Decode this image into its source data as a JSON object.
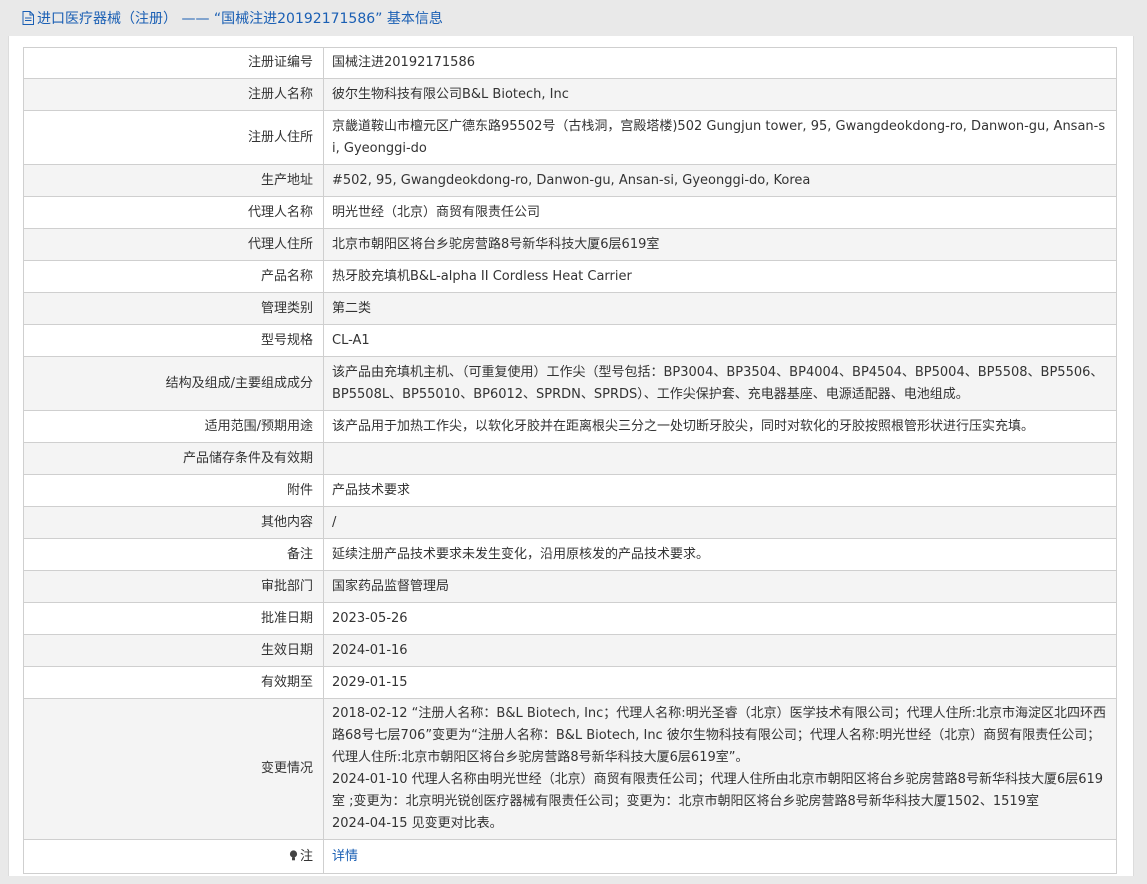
{
  "header": {
    "icon": "document-icon",
    "title": "进口医疗器械（注册） —— “国械注进20192171586” 基本信息"
  },
  "rows": [
    {
      "label": "注册证编号",
      "value": "国械注进20192171586"
    },
    {
      "label": "注册人名称",
      "value": "彼尔生物科技有限公司B&L Biotech, Inc"
    },
    {
      "label": "注册人住所",
      "value": "京畿道鞍山市檀元区广德东路95502号（古栈洞，宫殿塔楼)502 Gungjun tower, 95, Gwangdeokdong-ro, Danwon-gu, Ansan-si, Gyeonggi-do"
    },
    {
      "label": "生产地址",
      "value": "#502, 95, Gwangdeokdong-ro, Danwon-gu, Ansan-si, Gyeonggi-do, Korea"
    },
    {
      "label": "代理人名称",
      "value": "明光世经（北京）商贸有限责任公司"
    },
    {
      "label": "代理人住所",
      "value": "北京市朝阳区将台乡驼房营路8号新华科技大厦6层619室"
    },
    {
      "label": "产品名称",
      "value": "热牙胶充填机B&L-alpha II Cordless Heat Carrier"
    },
    {
      "label": "管理类别",
      "value": "第二类"
    },
    {
      "label": "型号规格",
      "value": "CL-A1"
    },
    {
      "label": "结构及组成/主要组成成分",
      "value": "该产品由充填机主机、（可重复使用）工作尖（型号包括：BP3004、BP3504、BP4004、BP4504、BP5004、BP5508、BP5506、BP5508L、BP55010、BP6012、SPRDN、SPRDS）、工作尖保护套、充电器基座、电源适配器、电池组成。"
    },
    {
      "label": "适用范围/预期用途",
      "value": "该产品用于加热工作尖，以软化牙胶并在距离根尖三分之一处切断牙胶尖，同时对软化的牙胶按照根管形状进行压实充填。"
    },
    {
      "label": "产品储存条件及有效期",
      "value": ""
    },
    {
      "label": "附件",
      "value": "产品技术要求"
    },
    {
      "label": "其他内容",
      "value": "/"
    },
    {
      "label": "备注",
      "value": "延续注册产品技术要求未发生变化，沿用原核发的产品技术要求。"
    },
    {
      "label": "审批部门",
      "value": "国家药品监督管理局"
    },
    {
      "label": "批准日期",
      "value": "2023-05-26"
    },
    {
      "label": "生效日期",
      "value": "2024-01-16"
    },
    {
      "label": "有效期至",
      "value": "2029-01-15"
    }
  ],
  "changes": {
    "label": "变更情况",
    "lines": [
      "2018-02-12 “注册人名称：B&L Biotech, Inc；代理人名称:明光圣睿（北京）医学技术有限公司；代理人住所:北京市海淀区北四环西路68号七层706”变更为“注册人名称：B&L Biotech, Inc 彼尔生物科技有限公司；代理人名称:明光世经（北京）商贸有限责任公司；代理人住所:北京市朝阳区将台乡驼房营路8号新华科技大厦6层619室”。",
      "2024-01-10 代理人名称由明光世经（北京）商贸有限责任公司；代理人住所由北京市朝阳区将台乡驼房营路8号新华科技大厦6层619室 ;变更为：北京明光锐创医疗器械有限责任公司；变更为：北京市朝阳区将台乡驼房营路8号新华科技大厦1502、1519室",
      "2024-04-15 见变更对比表。"
    ]
  },
  "note": {
    "icon": "lightbulb-icon",
    "label": "注",
    "link": "详情"
  },
  "colors": {
    "link": "#1a5fb4",
    "header_bg": "#e9e9e9",
    "row_alt": "#f4f4f4",
    "border": "#cfcfcf"
  }
}
